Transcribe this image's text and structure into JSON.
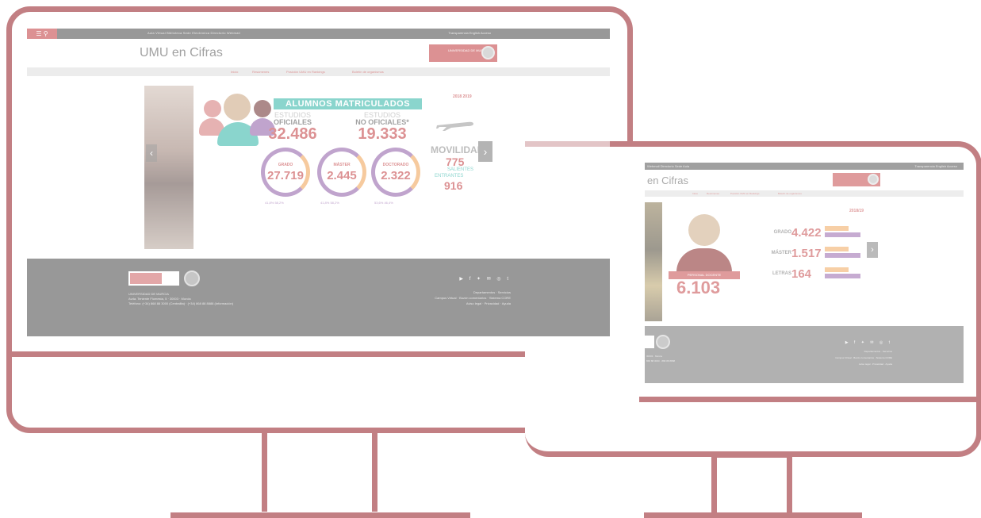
{
  "colors": {
    "frame": "#c27f83",
    "accent": "#c0393b",
    "teal": "#2bb3a6",
    "purple": "#8e5aa5",
    "orange": "#f0a050"
  },
  "screen1": {
    "topbar": {
      "menu_icon": "menu-icon",
      "search_icon": "search-icon",
      "links": "Aula Virtual  Biblioteca  Sede Electrónica  Directorio  Webmail",
      "right_links": "Transparencia  English  Acceso"
    },
    "site_title": "UMU en Cifras",
    "logo_text": "UNIVERSIDAD DE MURCIA",
    "menu": [
      "Inicio",
      "Resúmenes",
      "Posición UMU en Rankings",
      "Boletín de organismos"
    ],
    "infographic": {
      "banner": "ALUMNOS MATRICULADOS",
      "year_label": "2018 2019",
      "oficiales_top": "ESTUDIOS",
      "oficiales_bottom": "OFICIALES",
      "oficiales_value": "32.486",
      "nooficiales_top": "ESTUDIOS",
      "nooficiales_bottom": "NO OFICIALES*",
      "nooficiales_value": "19.333",
      "circles": [
        {
          "label": "GRADO",
          "value": "27.719",
          "gender": "41,8%  58,2%"
        },
        {
          "label": "MÁSTER",
          "value": "2.445",
          "gender": "41,8%  58,2%"
        },
        {
          "label": "DOCTORADO",
          "value": "2.322",
          "gender": "53,6%  46,4%"
        }
      ],
      "movilidad": "MOVILIDAD",
      "salientes_value": "775",
      "salientes_label": "SALIENTES",
      "entrantes_label": "ENTRANTES",
      "entrantes_value": "916"
    },
    "footer": {
      "university": "UNIVERSIDAD DE MURCIA",
      "address": "Avda. Teniente Flomesta, 5 · 30003 · Murcia",
      "phone": "Teléfono: (+34) 868 88 3000 (Centralita) · (+34) 868 88 8888 (Información)",
      "social": "▶ f ✦ ✉ ◎ t",
      "right1": "Departamentos · Servicios",
      "right2": "Campus Virtual · Buzón comentarios · Sistema CORE",
      "right3": "Aviso legal · Privacidad · Ayuda"
    }
  },
  "screen2": {
    "topbar_left": "Webmail  Directorio  Sede  Aula",
    "topbar_right": "Transparencia  English  Acceso",
    "site_title": "en Cifras",
    "menu": [
      "Inicio",
      "Resúmenes",
      "Posición UMU en Rankings",
      "Boletín de organismos"
    ],
    "year_label": "2018/19",
    "badge": "PERSONAL DOCENTE",
    "total": "6.103",
    "rows": [
      {
        "key": "GRADO",
        "value": "4.422"
      },
      {
        "key": "MÁSTER",
        "value": "1.517"
      },
      {
        "key": "LETRAS",
        "value": "164"
      }
    ],
    "footer_address": "30003 · Murcia",
    "footer_phone": "868 88 3000 · 868 88 8888",
    "footer_right1": "Departamentos · Servicios",
    "footer_right2": "Campus Virtual · Buzón comentarios · Sistema CORE",
    "footer_right3": "Aviso legal · Privacidad · Ayuda",
    "social": "▶ f ✦ ✉ ◎ t"
  }
}
